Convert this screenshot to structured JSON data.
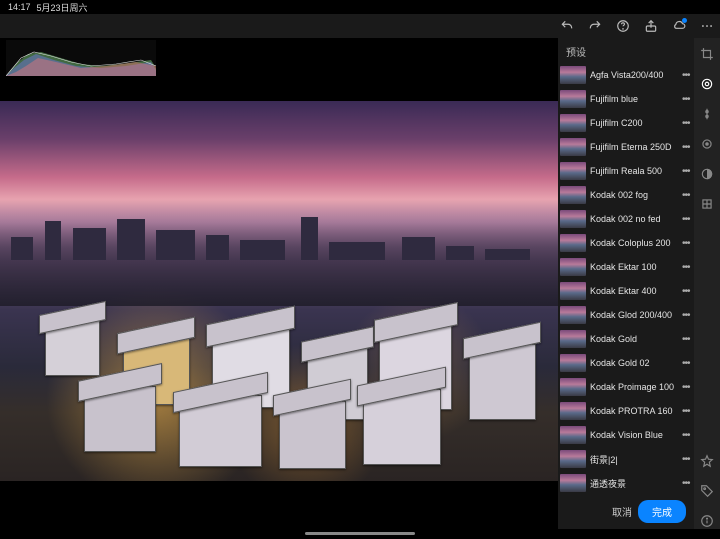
{
  "status": {
    "time": "14:17",
    "date": "5月23日周六"
  },
  "toolbar": {
    "undo": "undo-icon",
    "redo": "redo-icon",
    "help": "help-icon",
    "share": "share-icon",
    "cloud": "cloud-icon",
    "more": "more-icon"
  },
  "presets": {
    "title": "预设",
    "items": [
      {
        "label": "Agfa Vista200/400"
      },
      {
        "label": "Fujifilm blue"
      },
      {
        "label": "Fujifilm C200"
      },
      {
        "label": "Fujifilm Eterna 250D"
      },
      {
        "label": "Fujifilm Reala 500"
      },
      {
        "label": "Kodak 002 fog"
      },
      {
        "label": "Kodak 002 no fed"
      },
      {
        "label": "Kodak Coloplus 200"
      },
      {
        "label": "Kodak Ektar 100"
      },
      {
        "label": "Kodak Ektar 400"
      },
      {
        "label": "Kodak Glod 200/400"
      },
      {
        "label": "Kodak Gold"
      },
      {
        "label": "Kodak Gold 02"
      },
      {
        "label": "Kodak Proimage 100"
      },
      {
        "label": "Kodak PROTRA 160"
      },
      {
        "label": "Kodak Vision Blue"
      },
      {
        "label": "街景|2|"
      },
      {
        "label": "通透夜景"
      }
    ],
    "cancel": "取消",
    "done": "完成"
  },
  "rail": {
    "crop": "crop-icon",
    "presets": "presets-icon",
    "edit": "edit-sliders-icon",
    "heal": "heal-icon",
    "mask": "mask-icon",
    "geometry": "geometry-icon",
    "star": "star-icon",
    "tag": "tag-icon",
    "info": "info-icon"
  }
}
